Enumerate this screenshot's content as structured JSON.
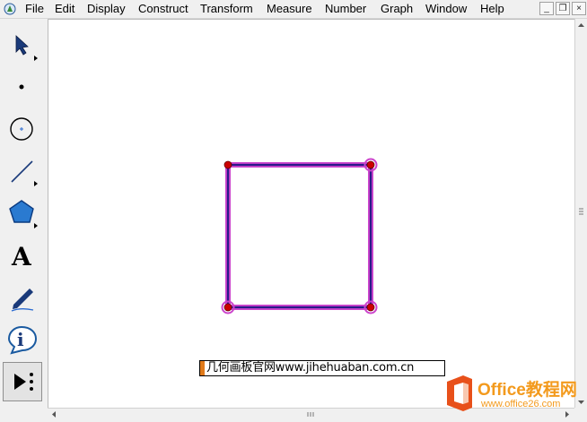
{
  "menubar": {
    "items": [
      "File",
      "Edit",
      "Display",
      "Construct",
      "Transform",
      "Measure",
      "Number",
      "Graph",
      "Window",
      "Help"
    ],
    "minimize": "_",
    "restore": "❐",
    "close": "×"
  },
  "toolbox": {
    "tools": [
      "arrow-tool",
      "point-tool",
      "compass-tool",
      "straightedge-tool",
      "polygon-tool",
      "text-tool",
      "marker-tool",
      "information-tool",
      "custom-tools"
    ],
    "selected": "custom-tools"
  },
  "canvas": {
    "shape": "square",
    "segment_color": "#2a1a8a",
    "highlight_color": "#cc44cc",
    "point_color": "#cc0000"
  },
  "caption": {
    "text": "几何画板官网www.jihehuaban.com.cn",
    "accent_color": "#e07a1a"
  },
  "watermark": {
    "title": "Office教程网",
    "url": "www.office26.com",
    "color": "#f39a1d"
  }
}
